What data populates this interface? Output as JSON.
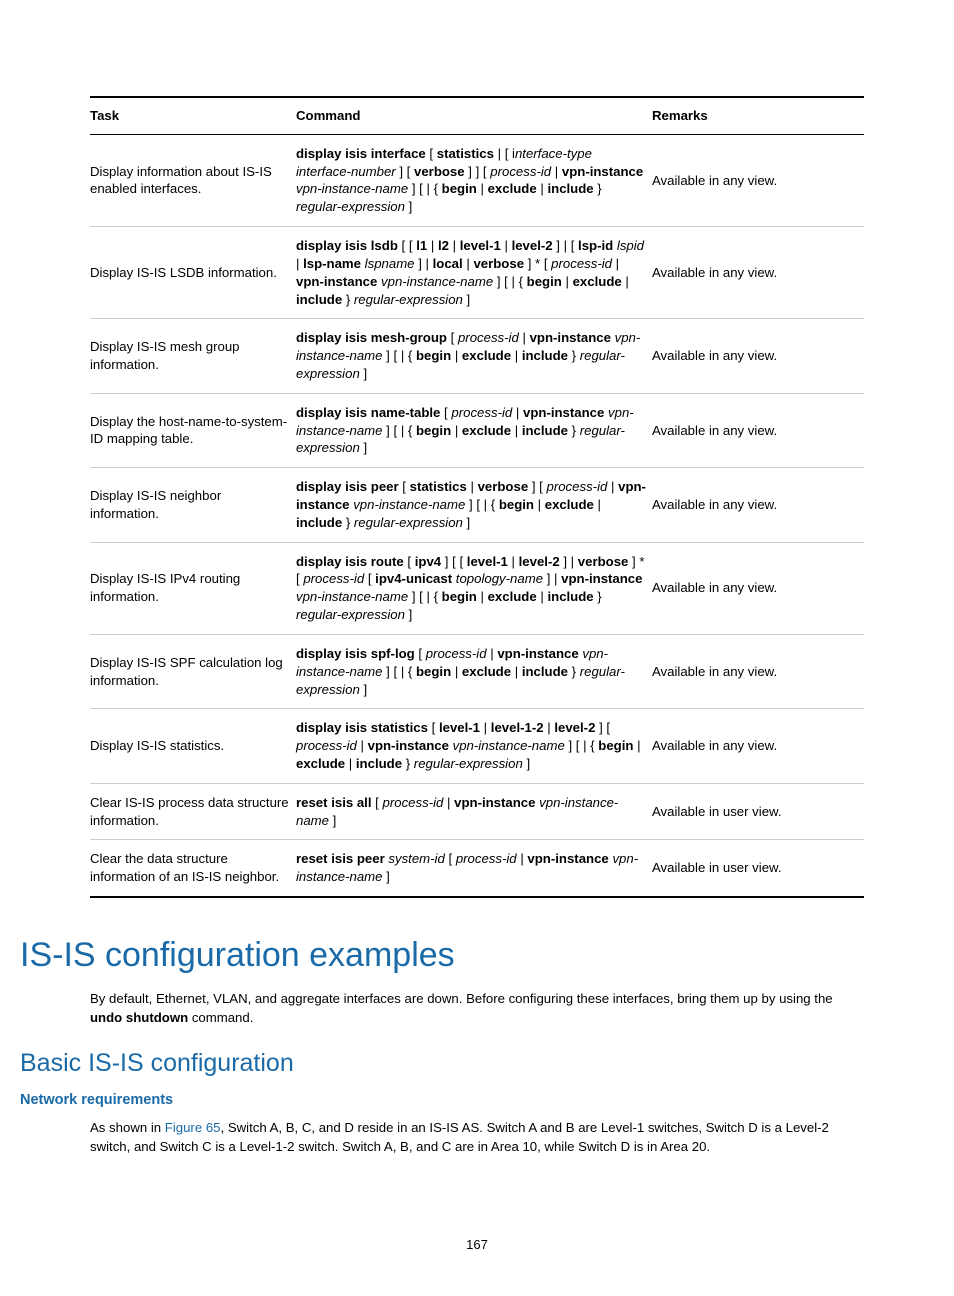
{
  "table": {
    "headers": {
      "task": "Task",
      "command": "Command",
      "remarks": "Remarks"
    },
    "rows": [
      {
        "task": "Display information about IS-IS enabled interfaces.",
        "remarks": "Available in any view."
      },
      {
        "task": "Display IS-IS LSDB information.",
        "remarks": "Available in any view."
      },
      {
        "task": "Display IS-IS mesh group information.",
        "remarks": "Available in any view."
      },
      {
        "task": "Display the host-name-to-system-ID mapping table.",
        "remarks": "Available in any view."
      },
      {
        "task": "Display IS-IS neighbor information.",
        "remarks": "Available in any view."
      },
      {
        "task": "Display IS-IS IPv4 routing information.",
        "remarks": "Available in any view."
      },
      {
        "task": "Display IS-IS SPF calculation log information.",
        "remarks": "Available in any view."
      },
      {
        "task": "Display IS-IS statistics.",
        "remarks": "Available in any view."
      },
      {
        "task": "Clear IS-IS process data structure information.",
        "remarks": "Available in user view."
      },
      {
        "task": "Clear the data structure information of an IS-IS neighbor.",
        "remarks": "Available in user view."
      }
    ],
    "commands": {
      "r0": {
        "a": "display isis interface",
        "b": " [ ",
        "c": "statistics",
        "d": " | [ i",
        "e": "nterface-type interface-number",
        "f": " ] [ ",
        "g": "verbose",
        "h": " ] ] [ ",
        "i": "process-id",
        "j": " | ",
        "k": "vpn-instance",
        "l": " ",
        "m": "vpn-instance-name",
        "n": " ] [ | { ",
        "o": "begin",
        "p": " | ",
        "q": "exclude",
        "r": " | ",
        "s": "include",
        "t": " } ",
        "u": "regular-expression",
        "v": " ]"
      },
      "r1": {
        "a": "display isis lsdb",
        "b": " [ [ ",
        "c": "l1",
        "d": " | ",
        "e": "l2",
        "f": " | ",
        "g": "level-1",
        "h": " | ",
        "i": "level-2",
        "j": " ] | [ ",
        "k": "lsp-id",
        "l": " ",
        "m": "lspid",
        "n": " | ",
        "o": "lsp-name",
        "p": " ",
        "q": "lspname",
        "r": " ] | ",
        "s": "local",
        "t": " | ",
        "u": "verbose",
        "v": " ] * [ ",
        "w": "process-id",
        "x": " | ",
        "y": "vpn-instance",
        "z": " ",
        "aa": "vpn-instance-name",
        "ab": " ] [ | { ",
        "ac": "begin",
        "ad": " | ",
        "ae": "exclude",
        "af": " | ",
        "ag": "include",
        "ah": " } ",
        "ai": "regular-expression",
        "aj": " ]"
      },
      "r2": {
        "a": "display isis mesh-group",
        "b": " [ ",
        "c": "process-id",
        "d": " | ",
        "e": "vpn-instance",
        "f": " ",
        "g": "vpn-instance-name",
        "h": " ] [ | { ",
        "i": "begin",
        "j": " | ",
        "k": "exclude",
        "l": " | ",
        "m": "include",
        "n": " } ",
        "o": "regular-expression",
        "p": " ]"
      },
      "r3": {
        "a": "display isis name-table",
        "b": " [ ",
        "c": "process-id",
        "d": " | ",
        "e": "vpn-instance",
        "f": " ",
        "g": "vpn-instance-name",
        "h": " ] [ | { ",
        "i": "begin",
        "j": " | ",
        "k": "exclude",
        "l": " | ",
        "m": "include",
        "n": " } ",
        "o": "regular-expression",
        "p": " ]"
      },
      "r4": {
        "a": "display isis peer",
        "b": " [ ",
        "c": "statistics",
        "d": " | ",
        "e": "verbose",
        "f": " ] [ ",
        "g": "process-id",
        "h": " | ",
        "i": "vpn-instance",
        "j": " ",
        "k": "vpn-instance-name",
        "l": " ] [ | { ",
        "m": "begin",
        "n": " | ",
        "o": "exclude",
        "p": " | ",
        "q": "include",
        "r": " } ",
        "s": "regular-expression",
        "t": " ]"
      },
      "r5": {
        "a": "display isis route",
        "b": " [ ",
        "c": "ipv4",
        "d": " ] [ [ ",
        "e": "level-1",
        "f": " | ",
        "g": "level-2",
        "h": " ] | ",
        "i": "verbose",
        "j": " ] * [ ",
        "k": "process-id",
        "l": " [ ",
        "m": "ipv4-unicast",
        "n": " ",
        "o": "topology-name",
        "p": " ] | ",
        "q": "vpn-instance",
        "r": " ",
        "s": "vpn-instance-name",
        "t": " ] [ | { ",
        "u": "begin",
        "v": " | ",
        "w": "exclude",
        "x": " | ",
        "y": "include",
        "z": " } ",
        "aa": "regular-expression",
        "ab": " ]"
      },
      "r6": {
        "a": "display isis spf-log",
        "b": " [ ",
        "c": "process-id",
        "d": " | ",
        "e": "vpn-instance",
        "f": " ",
        "g": "vpn-instance-name",
        "h": " ] [ | { ",
        "i": "begin",
        "j": " | ",
        "k": "exclude",
        "l": " | ",
        "m": "include",
        "n": " } ",
        "o": "regular-expression",
        "p": " ]"
      },
      "r7": {
        "a": "display isis statistics",
        "b": " [ ",
        "c": "level-1",
        "d": " | ",
        "e": "level-1-2",
        "f": " | ",
        "g": "level-2",
        "h": " ] [ ",
        "i": "process-id",
        "j": " | ",
        "k": "vpn-instance",
        "l": " ",
        "m": "vpn-instance-name",
        "n": " ] [ | { ",
        "o": "begin",
        "p": " | ",
        "q": "exclude",
        "r": " | ",
        "s": "include",
        "t": " } ",
        "u": "regular-expression",
        "v": " ]"
      },
      "r8": {
        "a": "reset isis all",
        "b": " [ ",
        "c": "process-id",
        "d": " | ",
        "e": "vpn-instance",
        "f": " ",
        "g": "vpn-instance-name",
        "h": " ]"
      },
      "r9": {
        "a": "reset isis peer",
        "b": " ",
        "c": "system-id",
        "d": " [ ",
        "e": "process-id",
        "f": " | ",
        "g": "vpn-instance",
        "h": " ",
        "i": "vpn-instance-name",
        "j": " ]"
      }
    }
  },
  "headings": {
    "h1": "IS-IS configuration examples",
    "h2": "Basic IS-IS configuration",
    "h3": "Network requirements"
  },
  "paragraphs": {
    "p1a": "By default, Ethernet, VLAN, and aggregate interfaces are down. Before configuring these interfaces, bring them up by using the ",
    "p1b": "undo shutdown",
    "p1c": " command.",
    "p2a": "As shown in ",
    "p2link": "Figure 65",
    "p2b": ", Switch A, B, C, and D reside in an IS-IS AS. Switch A and B are Level-1 switches, Switch D is a Level-2 switch, and Switch C is a Level-1-2 switch. Switch A, B, and C are in Area 10, while Switch D is in Area 20."
  },
  "pageNumber": "167"
}
